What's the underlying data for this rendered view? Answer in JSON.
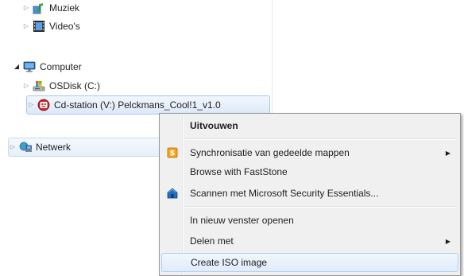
{
  "tree": {
    "libraries": [
      {
        "label": "Muziek",
        "icon": "music-library-icon"
      },
      {
        "label": "Video's",
        "icon": "video-library-icon"
      }
    ],
    "computer": {
      "label": "Computer",
      "icon": "computer-icon"
    },
    "drives": [
      {
        "label": "OSDisk (C:)",
        "icon": "hard-disk-icon"
      },
      {
        "label": "Cd-station (V:) Pelckmans_Cool!1_v1.0",
        "icon": "cd-drive-icon"
      }
    ],
    "network": {
      "label": "Netwerk",
      "icon": "network-icon"
    }
  },
  "context_menu": {
    "items": [
      {
        "label": "Uitvouwen",
        "bold": true
      },
      {
        "label": "Synchronisatie van gedeelde mappen",
        "icon": "sync-center-icon",
        "submenu": true
      },
      {
        "label": "Browse with FastStone"
      },
      {
        "label": "Scannen met Microsoft Security Essentials...",
        "icon": "security-essentials-icon"
      },
      {
        "label": "In nieuw venster openen"
      },
      {
        "label": "Delen met",
        "submenu": true
      },
      {
        "label": "Create ISO image",
        "highlighted": true
      }
    ]
  },
  "colors": {
    "selection_border": "#a8c7ec",
    "menu_background": "#f0f0f0",
    "menu_highlight_border": "#aecff7"
  }
}
